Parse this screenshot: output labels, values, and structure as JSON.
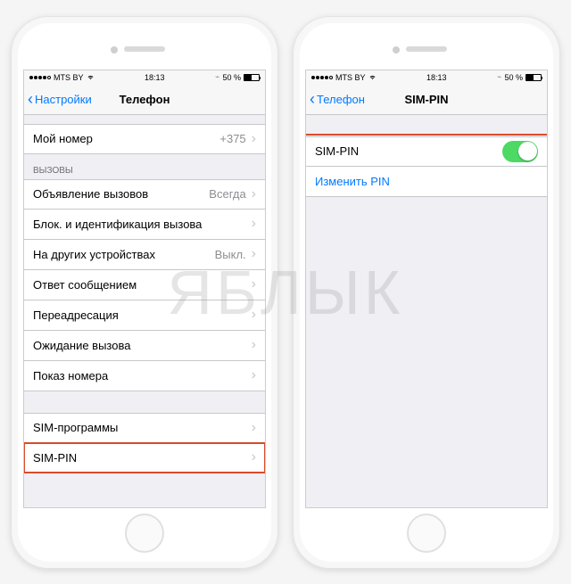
{
  "status": {
    "carrier": "MTS BY",
    "time": "18:13",
    "battery_text": "50 %"
  },
  "left": {
    "back_label": "Настройки",
    "title": "Телефон",
    "my_number": {
      "label": "Мой номер",
      "value": "+375"
    },
    "section_calls": "Вызовы",
    "rows": {
      "announce": {
        "label": "Объявление вызовов",
        "value": "Всегда"
      },
      "block_id": {
        "label": "Блок. и идентификация вызова"
      },
      "other_devices": {
        "label": "На других устройствах",
        "value": "Выкл."
      },
      "reply_msg": {
        "label": "Ответ сообщением"
      },
      "forwarding": {
        "label": "Переадресация"
      },
      "waiting": {
        "label": "Ожидание вызова"
      },
      "show_number": {
        "label": "Показ номера"
      }
    },
    "sim_apps": {
      "label": "SIM-программы"
    },
    "sim_pin": {
      "label": "SIM-PIN"
    }
  },
  "right": {
    "back_label": "Телефон",
    "title": "SIM-PIN",
    "sim_pin_toggle": {
      "label": "SIM-PIN"
    },
    "change_pin": {
      "label": "Изменить PIN"
    }
  },
  "watermark": "ЯБЛЫК"
}
